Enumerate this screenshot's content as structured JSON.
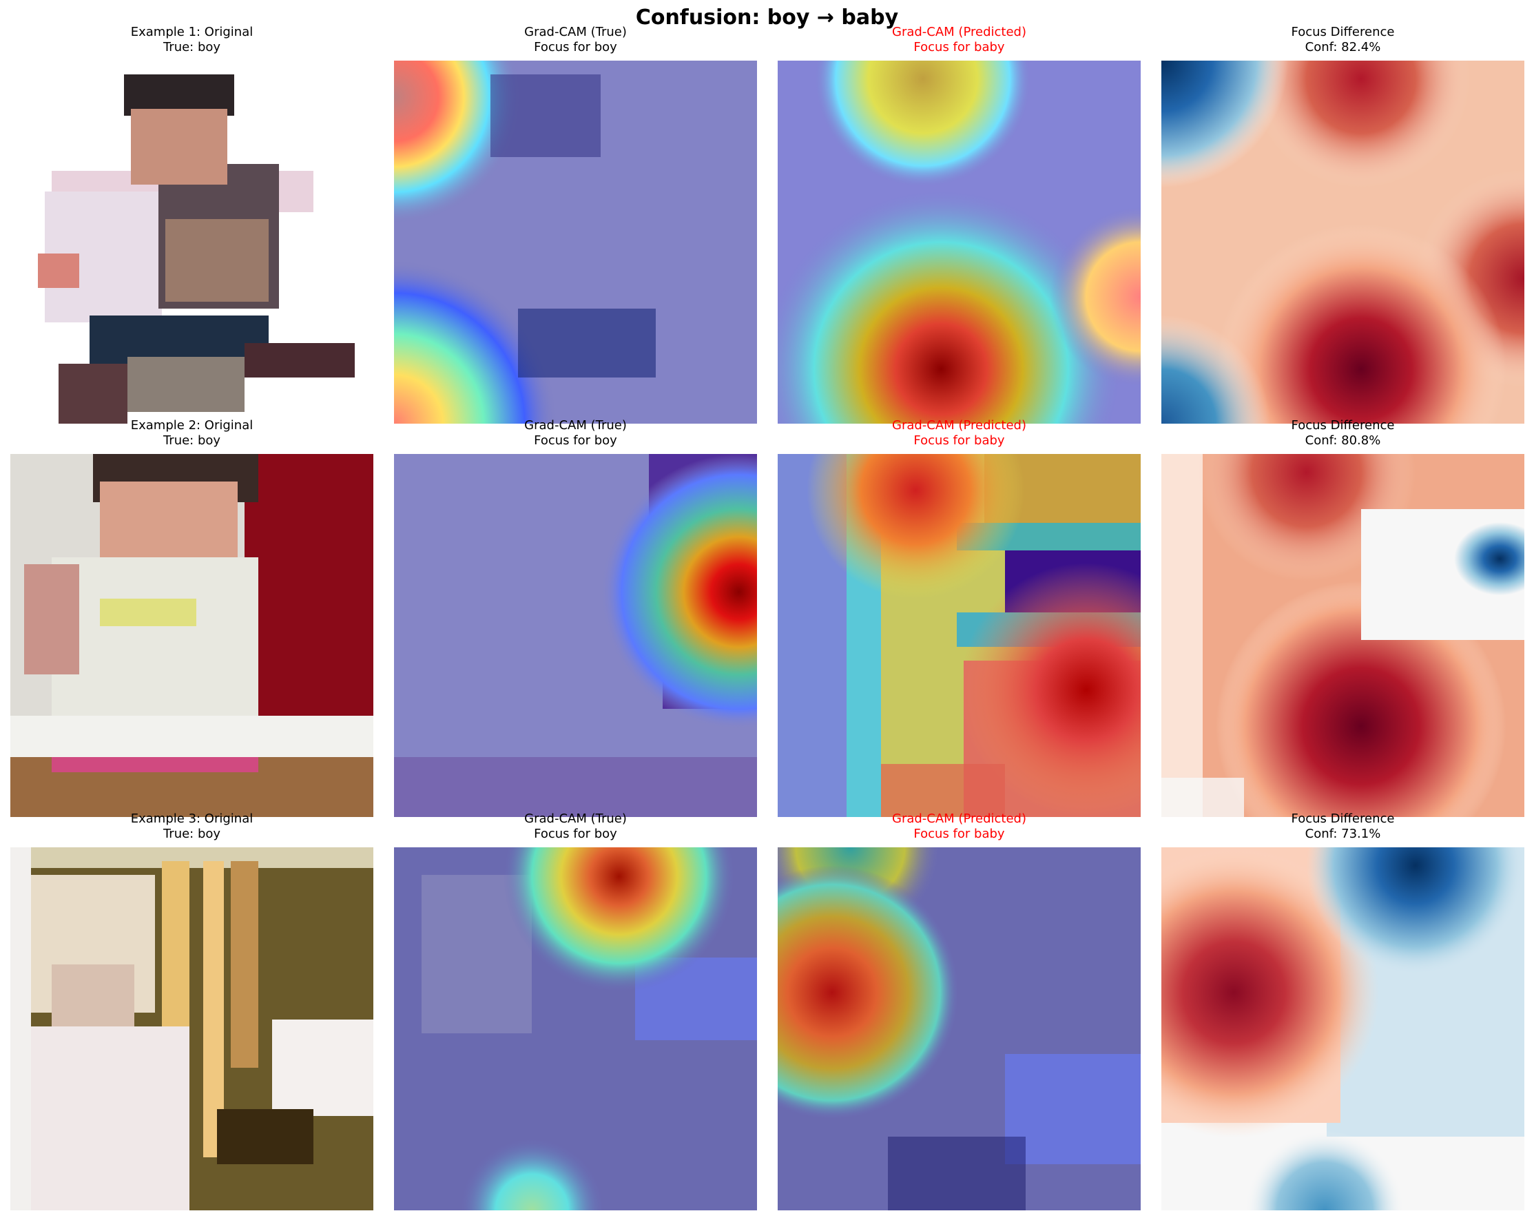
{
  "figure": {
    "title": "Confusion: boy → baby"
  },
  "rows": [
    {
      "original": {
        "line1": "Example 1: Original",
        "line2": "True: boy"
      },
      "true_cam": {
        "line1": "Grad-CAM (True)",
        "line2": "Focus for boy"
      },
      "pred_cam": {
        "line1": "Grad-CAM (Predicted)",
        "line2": "Focus for baby"
      },
      "difference": {
        "line1": "Focus Difference",
        "line2": "Conf: 82.4%"
      }
    },
    {
      "original": {
        "line1": "Example 2: Original",
        "line2": "True: boy"
      },
      "true_cam": {
        "line1": "Grad-CAM (True)",
        "line2": "Focus for boy"
      },
      "pred_cam": {
        "line1": "Grad-CAM (Predicted)",
        "line2": "Focus for baby"
      },
      "difference": {
        "line1": "Focus Difference",
        "line2": "Conf: 80.8%"
      }
    },
    {
      "original": {
        "line1": "Example 3: Original",
        "line2": "True: boy"
      },
      "true_cam": {
        "line1": "Grad-CAM (True)",
        "line2": "Focus for boy"
      },
      "pred_cam": {
        "line1": "Grad-CAM (Predicted)",
        "line2": "Focus for baby"
      },
      "difference": {
        "line1": "Focus Difference",
        "line2": "Conf: 73.1%"
      }
    }
  ],
  "colors": {
    "predicted_title": "#ff0000",
    "heatmap_low": "#00007f",
    "heatmap_high": "#7f0000",
    "difference_negative": "#053061",
    "difference_positive": "#67001f"
  }
}
